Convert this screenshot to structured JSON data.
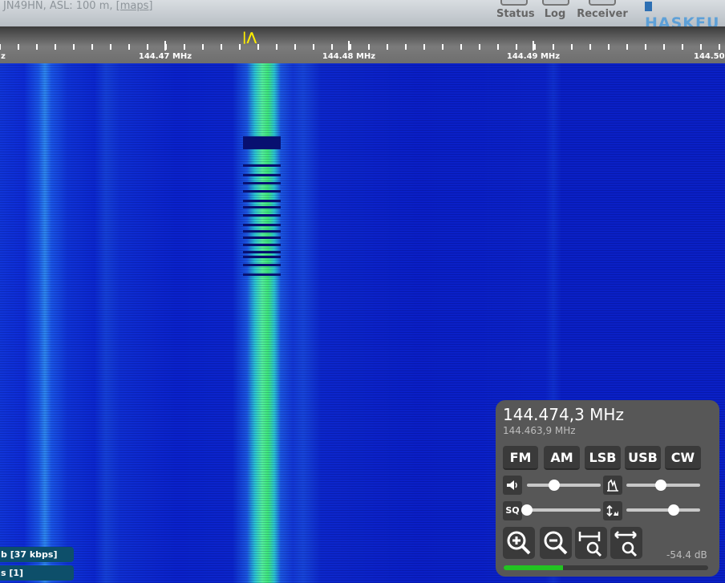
{
  "header": {
    "location": "JN49HN, ASL: 100 m,",
    "maps_link": "[maps]",
    "buttons": [
      {
        "label": "Status",
        "icon": "status-icon"
      },
      {
        "label": "Log",
        "icon": "log-icon"
      },
      {
        "label": "Receiver",
        "icon": "receiver-icon"
      }
    ],
    "logo_text": "HASKFU"
  },
  "scale": {
    "labels": [
      "z",
      "144.47 MHz",
      "144.48 MHz",
      "144.49 MHz",
      "144.50 M"
    ]
  },
  "status": {
    "bandwidth": "b [37 kbps]",
    "clients": "s [1]"
  },
  "panel": {
    "frequency": "144.474,3 MHz",
    "offset_frequency": "144.463,9 MHz",
    "modes": [
      "FM",
      "AM",
      "LSB",
      "USB",
      "CW"
    ],
    "volume_level": 0.37,
    "nr_level": 0.47,
    "squelch_level": 0.0,
    "agc_level": 0.64,
    "squelch_label": "SQ",
    "signal_level": "-54.4 dB",
    "smeter_fill": 0.29,
    "colors": {
      "smeter": "#22c322",
      "panel_bg": "#575757"
    }
  }
}
